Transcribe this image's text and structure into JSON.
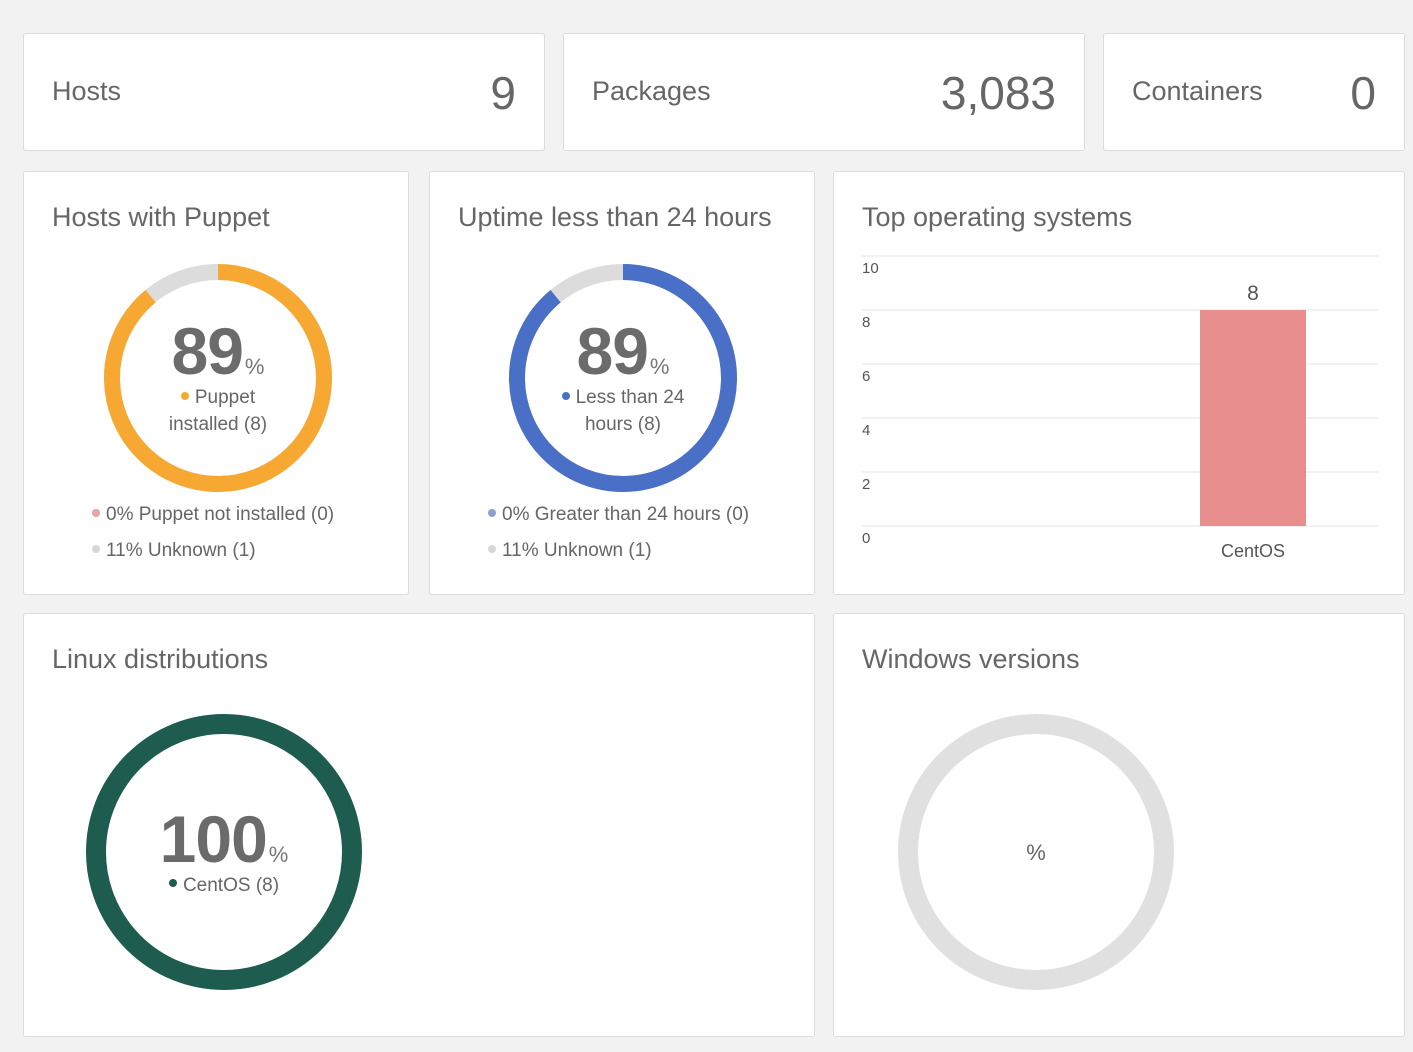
{
  "stats": [
    {
      "label": "Hosts",
      "value": "9"
    },
    {
      "label": "Packages",
      "value": "3,083"
    },
    {
      "label": "Containers",
      "value": "0"
    }
  ],
  "puppet": {
    "title": "Hosts with Puppet",
    "percent": "89",
    "percent_sign": "%",
    "center_label": "Puppet installed (8)",
    "segments": [
      {
        "name": "installed",
        "fraction": 0.89,
        "color": "#f7a833"
      },
      {
        "name": "unknown",
        "fraction": 0.11,
        "color": "#dcdcdc"
      }
    ],
    "legend": [
      {
        "text": "0% Puppet not installed (0)",
        "color": "#e9a3a3"
      },
      {
        "text": "11% Unknown (1)",
        "color": "#d6d6d6"
      }
    ]
  },
  "uptime": {
    "title": "Uptime less than 24 hours",
    "percent": "89",
    "percent_sign": "%",
    "center_label": "Less than 24 hours (8)",
    "segments": [
      {
        "name": "less-than-24",
        "fraction": 0.89,
        "color": "#4a6fc7"
      },
      {
        "name": "unknown",
        "fraction": 0.11,
        "color": "#dcdcdc"
      }
    ],
    "legend": [
      {
        "text": "0% Greater than 24 hours (0)",
        "color": "#8e9fd6"
      },
      {
        "text": "11% Unknown (1)",
        "color": "#d6d6d6"
      }
    ]
  },
  "top_os": {
    "title": "Top operating systems",
    "chart_data": {
      "type": "bar",
      "categories": [
        "CentOS"
      ],
      "values": [
        8
      ],
      "data_labels": [
        "8"
      ],
      "ylim": [
        0,
        10
      ],
      "yticks": [
        "0",
        "2",
        "4",
        "6",
        "8",
        "10"
      ],
      "grid": true,
      "bar_color": "#e88e8e"
    }
  },
  "linux": {
    "title": "Linux distributions",
    "percent": "100",
    "percent_sign": "%",
    "center_label": "CentOS (8)",
    "color": "#1e5c4f"
  },
  "windows": {
    "title": "Windows versions",
    "center_label": "%",
    "color": "#e0e0e0"
  }
}
